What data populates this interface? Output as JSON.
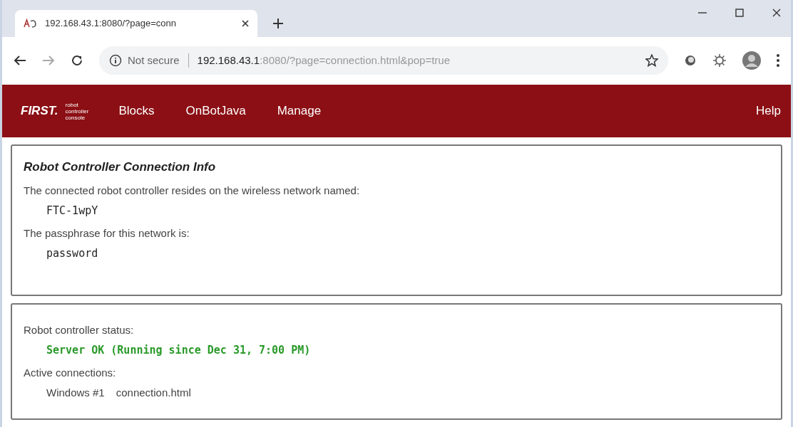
{
  "browser": {
    "tab_title": "192.168.43.1:8080/?page=conn",
    "security": "Not secure",
    "url_host": "192.168.43.1",
    "url_rest": ":8080/?page=connection.html&pop=true"
  },
  "navbar": {
    "logo": "FIRST.",
    "logo_sub": [
      "robot",
      "controller",
      "console"
    ],
    "items": [
      {
        "label": "Blocks"
      },
      {
        "label": "OnBotJava"
      },
      {
        "label": "Manage"
      }
    ],
    "right_item": "Help"
  },
  "info_card": {
    "title": "Robot Controller Connection Info",
    "fields": [
      {
        "label": "The connected robot controller resides on the wireless network named:",
        "value": "FTC-1wpY"
      },
      {
        "label": "The passphrase for this network is:",
        "value": "password"
      }
    ]
  },
  "status_card": {
    "status_label": "Robot controller status:",
    "status": "Server OK (Running since Dec 31, 7:00 PM)",
    "status_ok": true,
    "connections_label": "Active connections:",
    "connections": [
      {
        "window": "Windows #1",
        "page": "connection.html"
      }
    ]
  }
}
